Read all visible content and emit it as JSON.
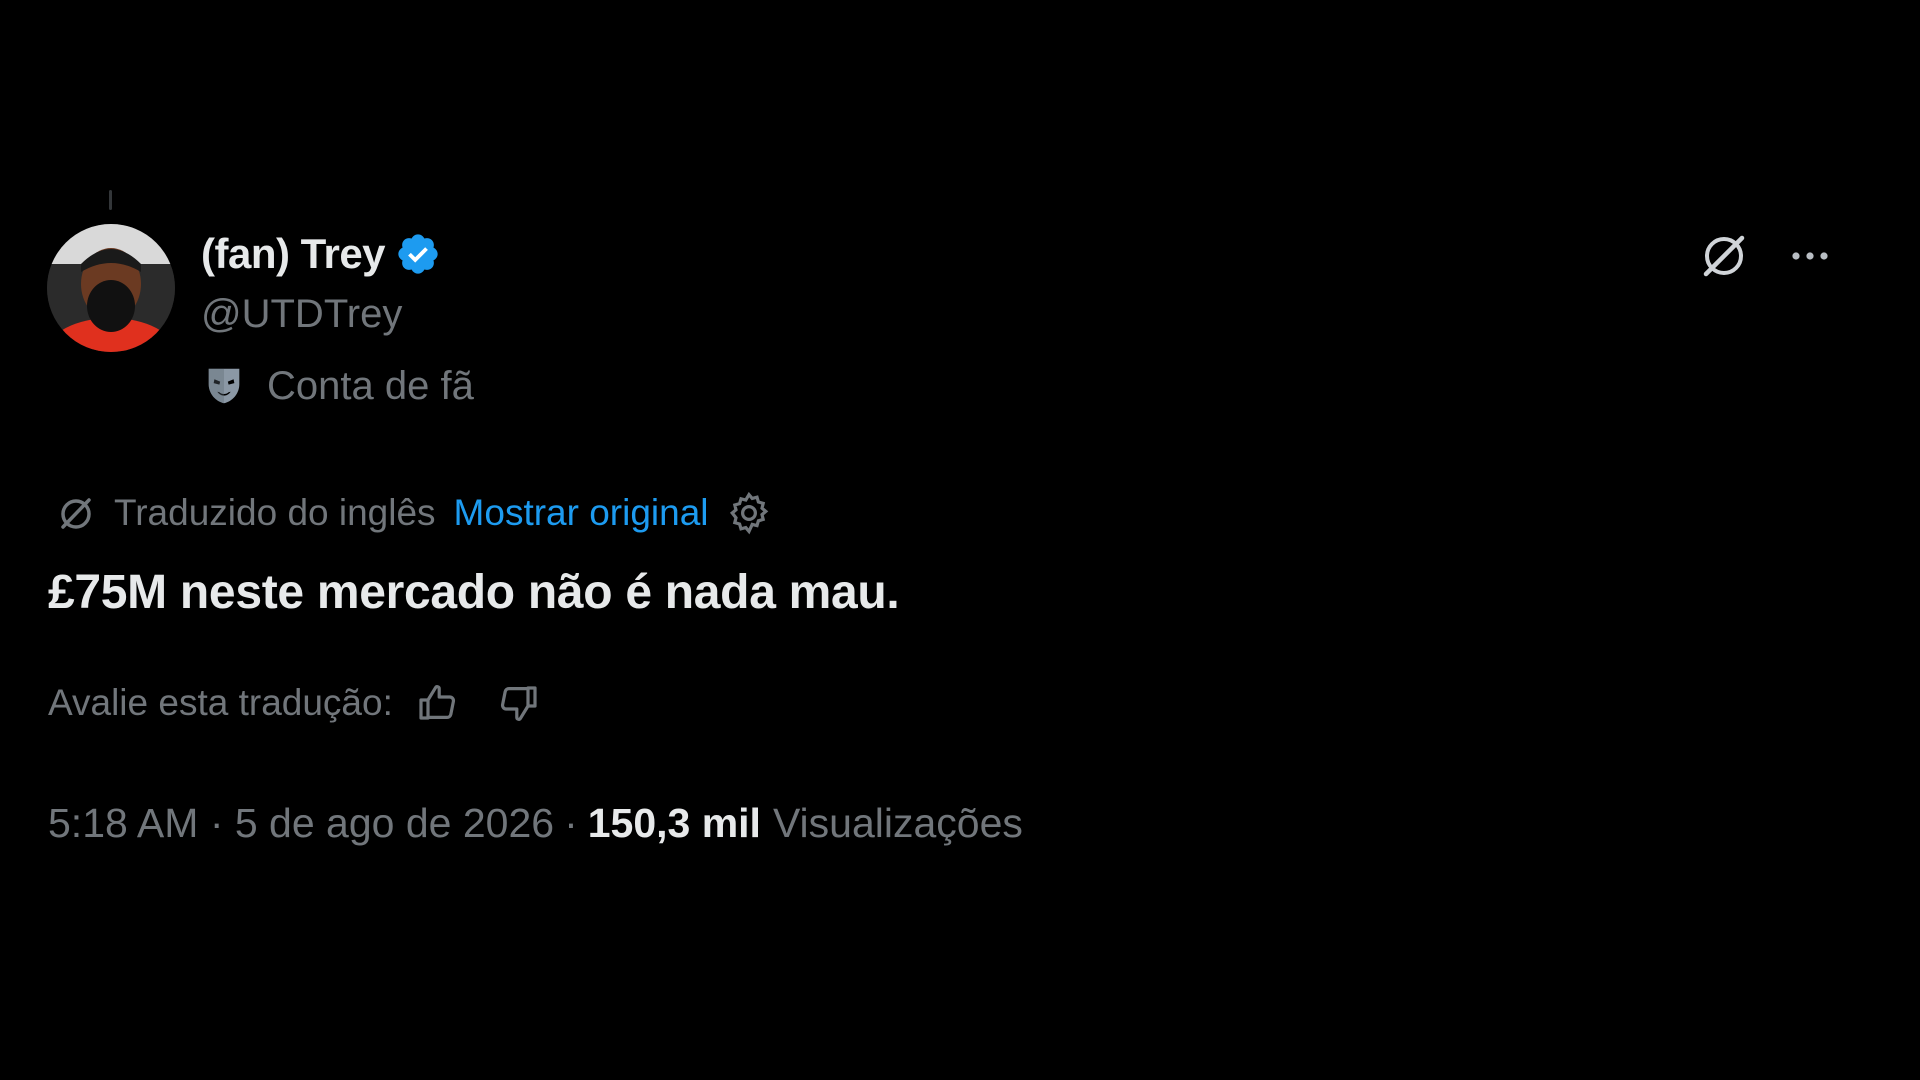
{
  "tweet": {
    "author": {
      "display_name": "(fan) Trey",
      "handle": "@UTDTrey",
      "verified": true,
      "badge_label": "Conta de fã",
      "avatar_icon": "avatar-photo"
    },
    "translation": {
      "translated_from": "Traduzido do inglês",
      "show_original": "Mostrar original"
    },
    "text": "£75M neste mercado não é nada mau.",
    "rate_translation_label": "Avalie esta tradução:",
    "timestamp": "5:18 AM · 5 de ago de 2026",
    "separator": "·",
    "views_count": "150,3 mil",
    "views_label": "Visualizações"
  },
  "icons": {
    "verified": "verified-badge-icon",
    "fan_account": "mask-icon",
    "grok": "grok-icon",
    "more": "more-options-icon",
    "translate": "translate-icon",
    "settings": "gear-icon",
    "thumb_up": "thumb-up-icon",
    "thumb_down": "thumb-down-icon"
  },
  "colors": {
    "background": "#000000",
    "primary_text": "#e7e9ea",
    "secondary_text": "#71767b",
    "accent": "#1d9bf0"
  }
}
